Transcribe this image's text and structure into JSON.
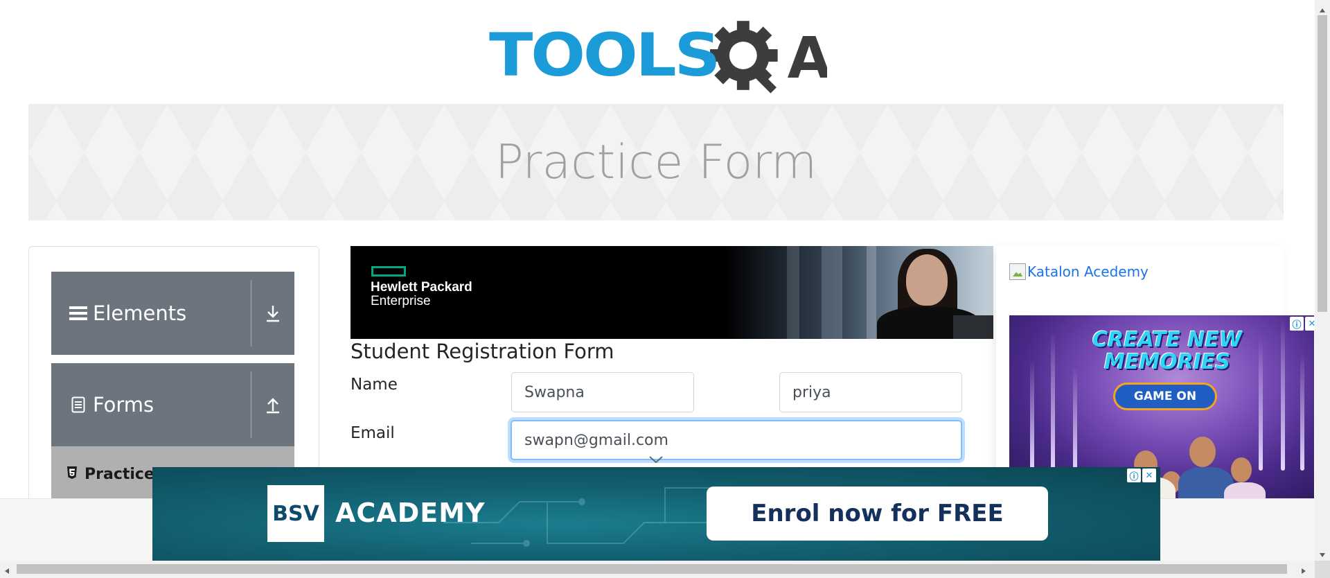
{
  "header": {
    "logo_text": "TOOLS",
    "logo_suffix": "A"
  },
  "banner": {
    "title": "Practice Form"
  },
  "sidebar": {
    "groups": [
      {
        "label": "Elements",
        "icon": "hamburger-icon",
        "toggle_icon": "download-arrow-icon"
      },
      {
        "label": "Forms",
        "icon": "document-icon",
        "toggle_icon": "upload-arrow-icon"
      }
    ],
    "active_item": {
      "label": "Practice",
      "icon": "html5-icon"
    }
  },
  "hpe_ad": {
    "brand_line1": "Hewlett Packard",
    "brand_line2": "Enterprise"
  },
  "form": {
    "title": "Student Registration Form",
    "name_label": "Name",
    "first_name_value": "Swapna",
    "last_name_value": "priya",
    "email_label": "Email",
    "email_value": "swapn@gmail.com"
  },
  "right_ads": {
    "katalon_alt": "Katalon Acedemy",
    "memories_headline_1": "CREATE NEW",
    "memories_headline_2": "MEMORIES",
    "memories_cta": "GAME ON"
  },
  "bottom_ad": {
    "logo": "BSV",
    "name": "ACADEMY",
    "cta": "Enrol now for FREE"
  },
  "colors": {
    "logo_blue": "#1b9bd7",
    "logo_dark": "#3d3d3d",
    "sidebar_group": "#6c757d",
    "focus_border": "#80bdff",
    "hpe_green": "#01a982"
  }
}
